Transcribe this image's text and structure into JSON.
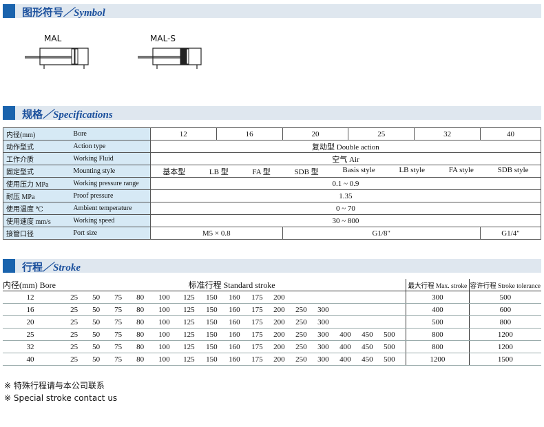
{
  "sections": {
    "symbol": {
      "cn": "图形符号",
      "en": "／Symbol"
    },
    "spec": {
      "cn": "规格",
      "en": "／Specifications"
    },
    "stroke": {
      "cn": "行程",
      "en": "／Stroke"
    }
  },
  "symbols": {
    "left": "MAL",
    "right": "MAL-S"
  },
  "spec": {
    "rows": [
      {
        "cn": "内径(mm)",
        "en": "Bore"
      },
      {
        "cn": "动作型式",
        "en": "Action type"
      },
      {
        "cn": "工作介质",
        "en": "Working Fluid"
      },
      {
        "cn": "固定型式",
        "en": "Mounting style"
      },
      {
        "cn": "使用压力 MPa",
        "en": "Working pressure range"
      },
      {
        "cn": "耐压 MPa",
        "en": "Proof pressure"
      },
      {
        "cn": "使用温度 ℃",
        "en": "Ambient temperature"
      },
      {
        "cn": "使用速度 mm/s",
        "en": "Working speed"
      },
      {
        "cn": "接管口径",
        "en": "Port size"
      }
    ],
    "bores": [
      "12",
      "16",
      "20",
      "25",
      "32",
      "40"
    ],
    "action": "复动型 Double action",
    "fluid": "空气 Air",
    "mounting": [
      "基本型",
      "LB 型",
      "FA 型",
      "SDB 型",
      "Basis style",
      "LB style",
      "FA style",
      "SDB style"
    ],
    "pressure": "0.1 ~ 0.9",
    "proof": "1.35",
    "temp": "0 ~ 70",
    "speed": "30 ~ 800",
    "ports": [
      "M5 × 0.8",
      "G1/8″",
      "G1/4″"
    ]
  },
  "stroke": {
    "headers": {
      "bore": "内径(mm) Bore",
      "std": "标准行程   Standard stroke",
      "max": "最大行程 Max. stroke",
      "tol": "容许行程 Stroke tolerance"
    },
    "rows": [
      {
        "bore": "12",
        "strokes": [
          "25",
          "50",
          "75",
          "80",
          "100",
          "125",
          "150",
          "160",
          "175",
          "200"
        ],
        "max": "300",
        "tol": "500"
      },
      {
        "bore": "16",
        "strokes": [
          "25",
          "50",
          "75",
          "80",
          "100",
          "125",
          "150",
          "160",
          "175",
          "200",
          "250",
          "300"
        ],
        "max": "400",
        "tol": "600"
      },
      {
        "bore": "20",
        "strokes": [
          "25",
          "50",
          "75",
          "80",
          "100",
          "125",
          "150",
          "160",
          "175",
          "200",
          "250",
          "300"
        ],
        "max": "500",
        "tol": "800"
      },
      {
        "bore": "25",
        "strokes": [
          "25",
          "50",
          "75",
          "80",
          "100",
          "125",
          "150",
          "160",
          "175",
          "200",
          "250",
          "300",
          "400",
          "450",
          "500"
        ],
        "max": "800",
        "tol": "1200"
      },
      {
        "bore": "32",
        "strokes": [
          "25",
          "50",
          "75",
          "80",
          "100",
          "125",
          "150",
          "160",
          "175",
          "200",
          "250",
          "300",
          "400",
          "450",
          "500"
        ],
        "max": "800",
        "tol": "1200"
      },
      {
        "bore": "40",
        "strokes": [
          "25",
          "50",
          "75",
          "80",
          "100",
          "125",
          "150",
          "160",
          "175",
          "200",
          "250",
          "300",
          "400",
          "450",
          "500"
        ],
        "max": "1200",
        "tol": "1500"
      }
    ]
  },
  "notes": [
    "※ 特殊行程请与本公司联系",
    "※ Special stroke contact us"
  ]
}
